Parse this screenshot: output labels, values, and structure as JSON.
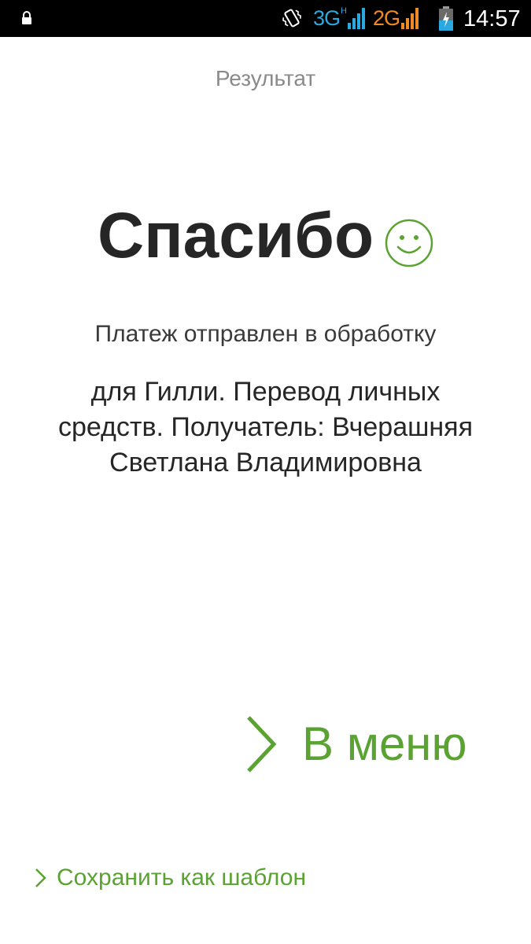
{
  "status_bar": {
    "network_3g": "3G",
    "network_3g_sub": "H",
    "network_2g": "2G",
    "time": "14:57",
    "color_3g": "#2aa8e0",
    "color_2g": "#f08a24",
    "color_battery": "#2aa8e0",
    "icons": [
      "lock-icon",
      "vibrate-icon",
      "signal-3g-icon",
      "signal-2g-icon",
      "battery-charging-icon"
    ]
  },
  "header": {
    "title": "Результат"
  },
  "result": {
    "heading": "Спасибо",
    "heading_icon": "smile-icon",
    "status": "Платеж отправлен в обработку",
    "details": "для Гилли. Перевод личных средств. Получатель: Вчерашняя Светлана Владимировна"
  },
  "actions": {
    "menu_label": "В меню",
    "save_template_label": "Сохранить как шаблон",
    "accent_color": "#5aa332"
  }
}
